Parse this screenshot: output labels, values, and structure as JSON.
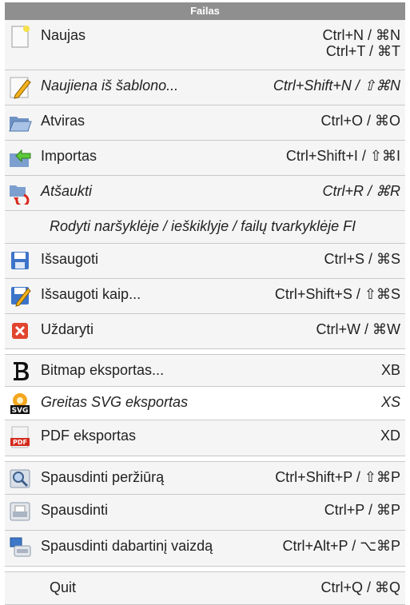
{
  "menu": {
    "title": "Failas",
    "items": [
      {
        "label": "Naujas",
        "shortcut": "Ctrl+N / ⌘N",
        "shortcut2": "Ctrl+T / ⌘T",
        "icon": "new-file-icon"
      },
      {
        "label": "Naujiena iš šablono...",
        "shortcut": "Ctrl+Shift+N / ⇧⌘N",
        "icon": "pencil-icon"
      },
      {
        "label": "Atviras",
        "shortcut": "Ctrl+O / ⌘O",
        "icon": "folder-open-icon"
      },
      {
        "label": "Importas",
        "shortcut": "Ctrl+Shift+I / ⇧⌘I",
        "icon": "import-icon"
      },
      {
        "label": "Atšaukti",
        "shortcut": "Ctrl+R / ⌘R",
        "icon": "revert-icon"
      },
      {
        "label": "Rodyti naršyklėje / ieškiklyje / failų tvarkyklėje FI",
        "shortcut": ""
      },
      {
        "label": "Išsaugoti",
        "shortcut": "Ctrl+S / ⌘S",
        "icon": "save-icon"
      },
      {
        "label": "Išsaugoti kaip...",
        "shortcut": "Ctrl+Shift+S / ⇧⌘S",
        "icon": "save-as-icon"
      },
      {
        "label": "Uždaryti",
        "shortcut": "Ctrl+W / ⌘W",
        "icon": "close-icon"
      },
      {
        "label": "Bitmap eksportas...",
        "shortcut": "XB",
        "icon": "bitmap-icon"
      },
      {
        "label": "Greitas SVG eksportas",
        "shortcut": "XS",
        "icon": "svg-icon"
      },
      {
        "label": "PDF eksportas",
        "shortcut": "XD",
        "icon": "pdf-icon"
      },
      {
        "label": "Spausdinti peržiūrą",
        "shortcut": "Ctrl+Shift+P / ⇧⌘P",
        "icon": "print-preview-icon"
      },
      {
        "label": "Spausdinti",
        "shortcut": "Ctrl+P / ⌘P",
        "icon": "printer-icon"
      },
      {
        "label": "Spausdinti dabartinį vaizdą",
        "shortcut": "Ctrl+Alt+P / ⌥⌘P",
        "icon": "print-view-icon"
      },
      {
        "label": "Quit",
        "shortcut": "Ctrl+Q / ⌘Q"
      }
    ]
  }
}
